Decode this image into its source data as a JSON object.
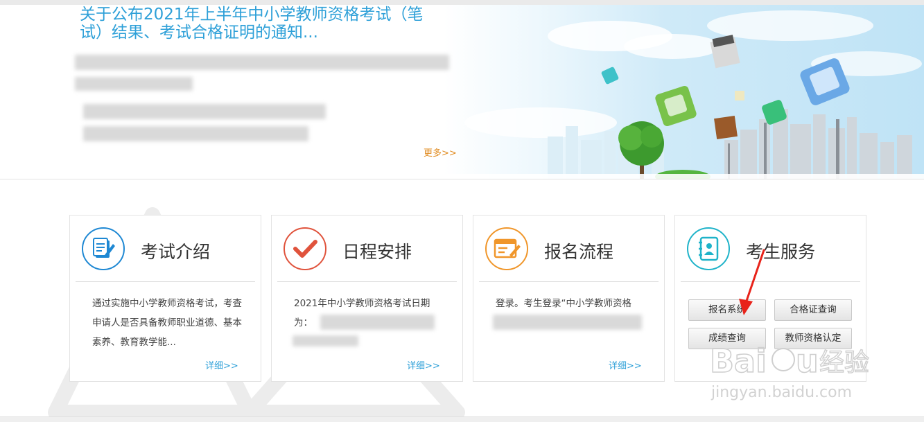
{
  "banner": {
    "title_line1": "关于公布2021年上半年中小学教师资格考试（笔",
    "title_line2": "试）结果、考试合格证明的通知...",
    "more_label": "更多>>"
  },
  "cards": [
    {
      "title": "考试介绍",
      "desc": "通过实施中小学教师资格考试，考查申请人是否具备教师职业道德、基本素养、教育教学能...",
      "detail": "详细>>",
      "accent": "#1e88d3"
    },
    {
      "title": "日程安排",
      "desc": "2021年中小学教师资格考试日期为：",
      "detail": "详细>>",
      "accent": "#e0533c"
    },
    {
      "title": "报名流程",
      "desc": "登录。考生登录“中小学教师资格",
      "detail": "详细>>",
      "accent": "#f0962a"
    },
    {
      "title": "考生服务",
      "accent": "#1fb3c9"
    }
  ],
  "services": {
    "register": "报名系统",
    "certificate_query": "合格证查询",
    "score_query": "成绩查询",
    "qualification": "教师资格认定"
  },
  "watermark": {
    "logo": "Baidu经验",
    "url": "jingyan.baidu.com"
  },
  "colors": {
    "accent_blue": "#2ea0d8",
    "more_orange": "#e08a1e",
    "arrow_red": "#e8231a"
  }
}
